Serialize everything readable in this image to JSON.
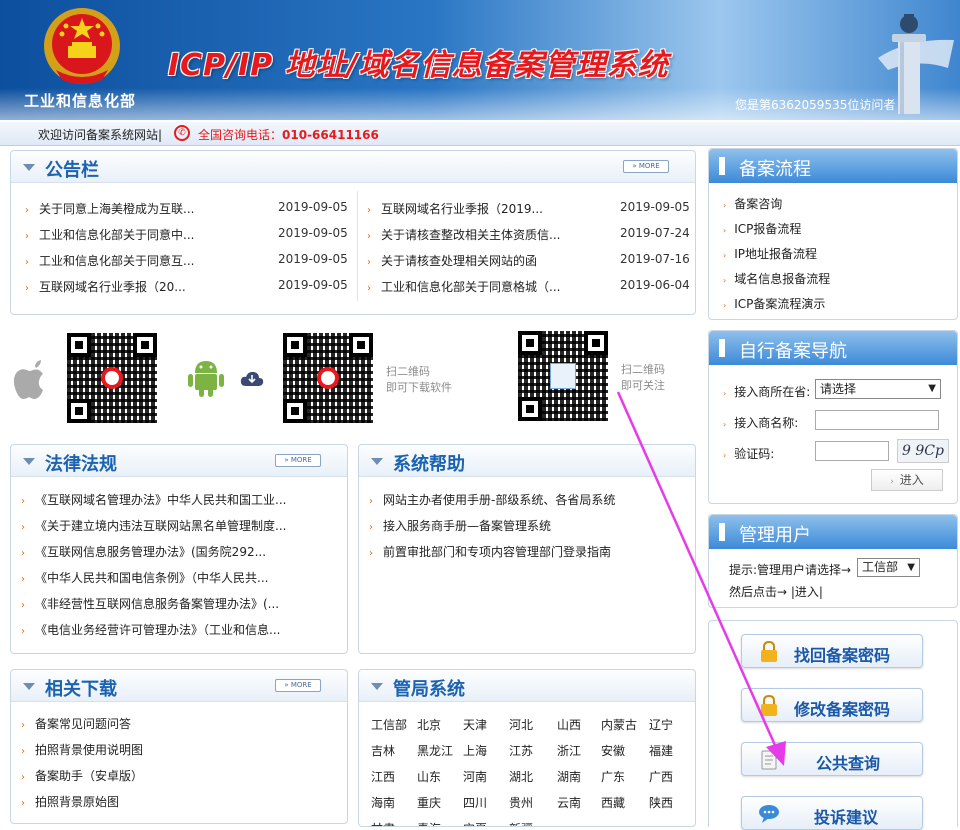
{
  "header": {
    "ministry": "工业和信息化部",
    "title": "ICP/IP 地址/域名信息备案管理系统",
    "visitor": "您是第6362059535位访问者"
  },
  "topbar": {
    "welcome": "欢迎访问备案系统网站|",
    "phone_label": "全国咨询电话：",
    "phone_number": "010-66411166"
  },
  "more_label": "» MORE",
  "notice": {
    "title": "公告栏",
    "left": [
      {
        "text": "关于同意上海美橙成为互联...",
        "date": "2019-09-05"
      },
      {
        "text": "工业和信息化部关于同意中...",
        "date": "2019-09-05"
      },
      {
        "text": "工业和信息化部关于同意互...",
        "date": "2019-09-05"
      },
      {
        "text": "互联网域名行业季报（20...",
        "date": "2019-09-05"
      }
    ],
    "right": [
      {
        "text": "互联网域名行业季报（2019...",
        "date": "2019-09-05"
      },
      {
        "text": "关于请核查整改相关主体资质信...",
        "date": "2019-07-24"
      },
      {
        "text": "关于请核查处理相关网站的函",
        "date": "2019-07-16"
      },
      {
        "text": "工业和信息化部关于同意格城（...",
        "date": "2019-06-04"
      }
    ]
  },
  "qr": {
    "download_text": [
      "扫二维码",
      "即可下载软件"
    ],
    "follow_text": [
      "扫二维码",
      "即可关注"
    ]
  },
  "law": {
    "title": "法律法规",
    "items": [
      "《互联网域名管理办法》中华人民共和国工业...",
      "《关于建立境内违法互联网站黑名单管理制度...",
      "《互联网信息服务管理办法》(国务院292...",
      "《中华人民共和国电信条例》（中华人民共...",
      "《非经营性互联网信息服务备案管理办法》(...",
      "《电信业务经营许可管理办法》（工业和信息..."
    ]
  },
  "help": {
    "title": "系统帮助",
    "items": [
      "网站主办者使用手册-部级系统、各省局系统",
      "接入服务商手册—备案管理系统",
      "前置审批部门和专项内容管理部门登录指南"
    ]
  },
  "download": {
    "title": "相关下载",
    "items": [
      "备案常见问题问答",
      "拍照背景使用说明图",
      "备案助手（安卓版）",
      "拍照背景原始图"
    ]
  },
  "bureau": {
    "title": "管局系统",
    "rows": [
      [
        "工信部",
        "北京",
        "天津",
        "河北",
        "山西",
        "内蒙古",
        "辽宁"
      ],
      [
        "吉林",
        "黑龙江",
        "上海",
        "江苏",
        "浙江",
        "安徽",
        "福建"
      ],
      [
        "江西",
        "山东",
        "河南",
        "湖北",
        "湖南",
        "广东",
        "广西"
      ],
      [
        "海南",
        "重庆",
        "四川",
        "贵州",
        "云南",
        "西藏",
        "陕西"
      ],
      [
        "甘肃",
        "青海",
        "宁夏",
        "新疆",
        "",
        "",
        ""
      ]
    ]
  },
  "process": {
    "title": "备案流程",
    "items": [
      "备案咨询",
      "ICP报备流程",
      "IP地址报备流程",
      "域名信息报备流程",
      "ICP备案流程演示"
    ]
  },
  "nav": {
    "title": "自行备案导航",
    "location_label": "接入商所在省:",
    "location_value": "请选择",
    "name_label": "接入商名称:",
    "name_value": "",
    "captcha_label": "验证码:",
    "captcha_value": "",
    "captcha_image_text": "9 9Cp",
    "enter_label": "进入"
  },
  "admin": {
    "title": "管理用户",
    "hint": "提示:管理用户请选择→",
    "select_value": "工信部",
    "then": "然后点击→ |进入|"
  },
  "buttons": {
    "recover": "找回备案密码",
    "change": "修改备案密码",
    "query": "公共查询",
    "complaint": "投诉建议"
  },
  "colors": {
    "accent_blue": "#1b63b1",
    "brand_red": "#e8191d",
    "bullet_orange": "#e06a10",
    "annotation_magenta": "#e53be8"
  }
}
